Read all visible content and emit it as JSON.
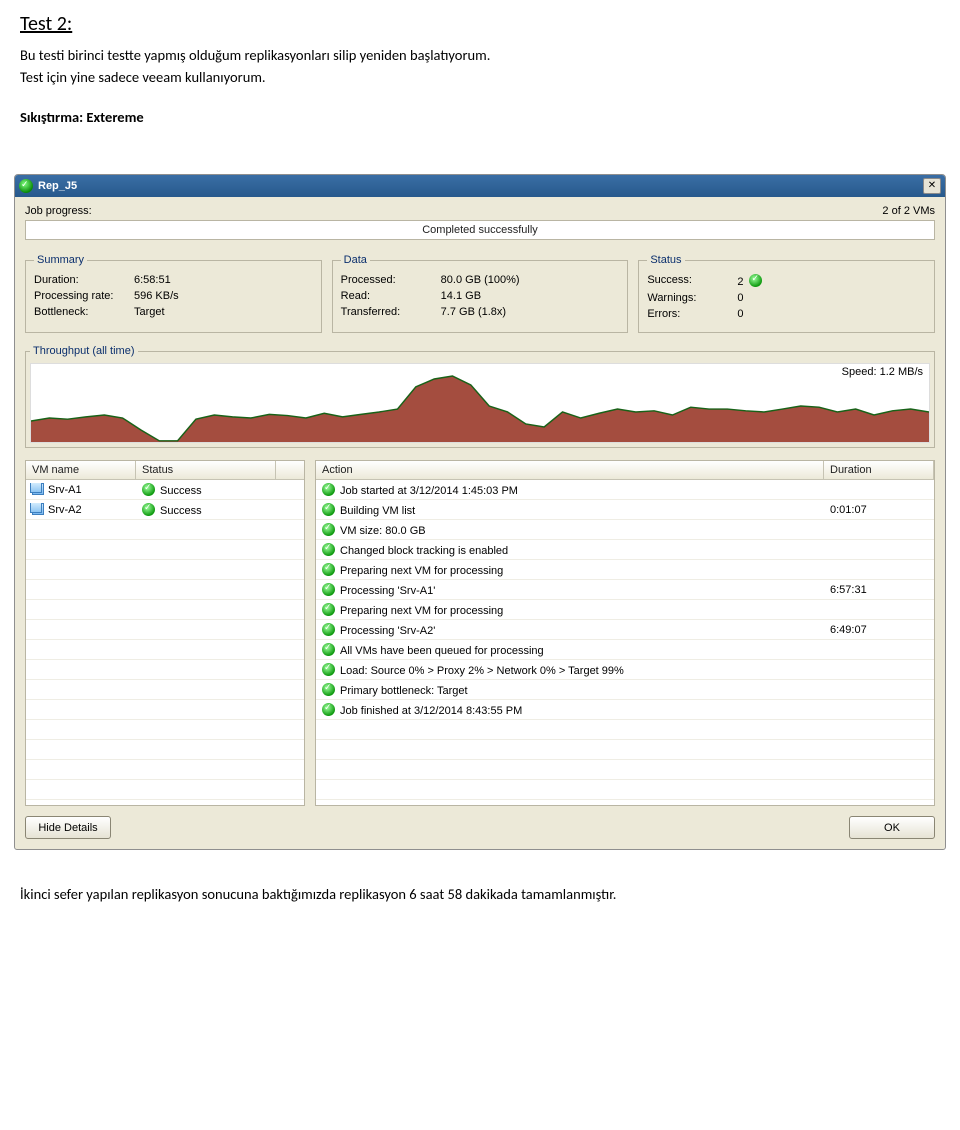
{
  "doc": {
    "heading": "Test 2:",
    "line1": "Bu testi birinci testte yapmış olduğum replikasyonları silip yeniden başlatıyorum.",
    "line2": "Test için yine sadece veeam kullanıyorum.",
    "compression": "Sıkıştırma: Extereme",
    "footer": "İkinci sefer yapılan replikasyon sonucuna baktığımızda replikasyon 6 saat 58 dakikada tamamlanmıştır."
  },
  "window": {
    "title": "Rep_J5",
    "progress": {
      "label": "Job progress:",
      "vms_text": "2 of 2 VMs",
      "status_text": "Completed successfully"
    },
    "summary": {
      "legend": "Summary",
      "duration_label": "Duration:",
      "duration_value": "6:58:51",
      "rate_label": "Processing rate:",
      "rate_value": "596 KB/s",
      "bottleneck_label": "Bottleneck:",
      "bottleneck_value": "Target"
    },
    "data": {
      "legend": "Data",
      "processed_label": "Processed:",
      "processed_value": "80.0 GB (100%)",
      "read_label": "Read:",
      "read_value": "14.1 GB",
      "transferred_label": "Transferred:",
      "transferred_value": "7.7 GB (1.8x)"
    },
    "status": {
      "legend": "Status",
      "success_label": "Success:",
      "success_value": "2",
      "warnings_label": "Warnings:",
      "warnings_value": "0",
      "errors_label": "Errors:",
      "errors_value": "0"
    },
    "throughput": {
      "legend": "Throughput (all time)",
      "speed_text": "Speed: 1.2 MB/s"
    },
    "vm_table": {
      "headers": {
        "name": "VM name",
        "status": "Status"
      },
      "rows": [
        {
          "name": "Srv-A1",
          "status": "Success"
        },
        {
          "name": "Srv-A2",
          "status": "Success"
        }
      ]
    },
    "action_table": {
      "headers": {
        "action": "Action",
        "duration": "Duration"
      },
      "rows": [
        {
          "text": "Job started at 3/12/2014 1:45:03 PM",
          "duration": ""
        },
        {
          "text": "Building VM list",
          "duration": "0:01:07"
        },
        {
          "text": "VM size: 80.0 GB",
          "duration": ""
        },
        {
          "text": "Changed block tracking is enabled",
          "duration": ""
        },
        {
          "text": "Preparing next VM for processing",
          "duration": ""
        },
        {
          "text": "Processing 'Srv-A1'",
          "duration": "6:57:31"
        },
        {
          "text": "Preparing next VM for processing",
          "duration": ""
        },
        {
          "text": "Processing 'Srv-A2'",
          "duration": "6:49:07"
        },
        {
          "text": "All VMs have been queued for processing",
          "duration": ""
        },
        {
          "text": "Load: Source 0% > Proxy 2% > Network 0% > Target 99%",
          "duration": ""
        },
        {
          "text": "Primary bottleneck: Target",
          "duration": ""
        },
        {
          "text": "Job finished at 3/12/2014 8:43:55 PM",
          "duration": ""
        }
      ]
    },
    "buttons": {
      "hide_details": "Hide Details",
      "ok": "OK"
    }
  },
  "chart_data": {
    "type": "area",
    "title": "Throughput (all time)",
    "ylabel": "MB/s",
    "ylim": [
      0,
      1.3
    ],
    "speed_label": "Speed: 1.2 MB/s",
    "x": [
      0,
      1,
      2,
      3,
      4,
      5,
      6,
      7,
      8,
      9,
      10,
      11,
      12,
      13,
      14,
      15,
      16,
      17,
      18,
      19,
      20,
      21,
      22,
      23,
      24,
      25,
      26,
      27,
      28,
      29,
      30,
      31,
      32,
      33,
      34,
      35,
      36,
      37,
      38,
      39,
      40,
      41,
      42,
      43,
      44,
      45,
      46,
      47,
      48,
      49
    ],
    "values": [
      0.35,
      0.4,
      0.38,
      0.42,
      0.45,
      0.4,
      0.2,
      0.02,
      0.02,
      0.38,
      0.45,
      0.42,
      0.4,
      0.46,
      0.44,
      0.4,
      0.48,
      0.42,
      0.46,
      0.5,
      0.55,
      0.92,
      1.05,
      1.1,
      0.95,
      0.6,
      0.5,
      0.3,
      0.25,
      0.5,
      0.4,
      0.48,
      0.55,
      0.5,
      0.52,
      0.45,
      0.58,
      0.55,
      0.55,
      0.52,
      0.5,
      0.55,
      0.6,
      0.58,
      0.5,
      0.55,
      0.45,
      0.52,
      0.55,
      0.5
    ],
    "colors": {
      "fill": "#9a3a2a",
      "stroke": "#186218"
    }
  }
}
